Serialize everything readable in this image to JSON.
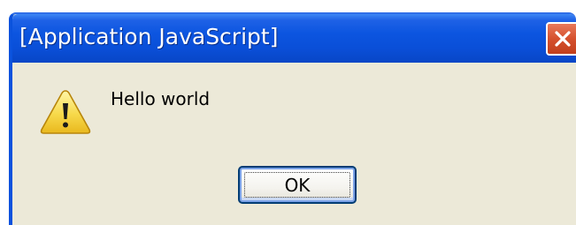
{
  "dialog": {
    "title": "[Application JavaScript]",
    "message": "Hello world",
    "ok_label": "OK",
    "icon": "warning-icon"
  },
  "colors": {
    "titlebar": "#0a4fd8",
    "body": "#ece9d8",
    "close_button": "#d5512e",
    "warning_fill": "#f7d94a"
  }
}
